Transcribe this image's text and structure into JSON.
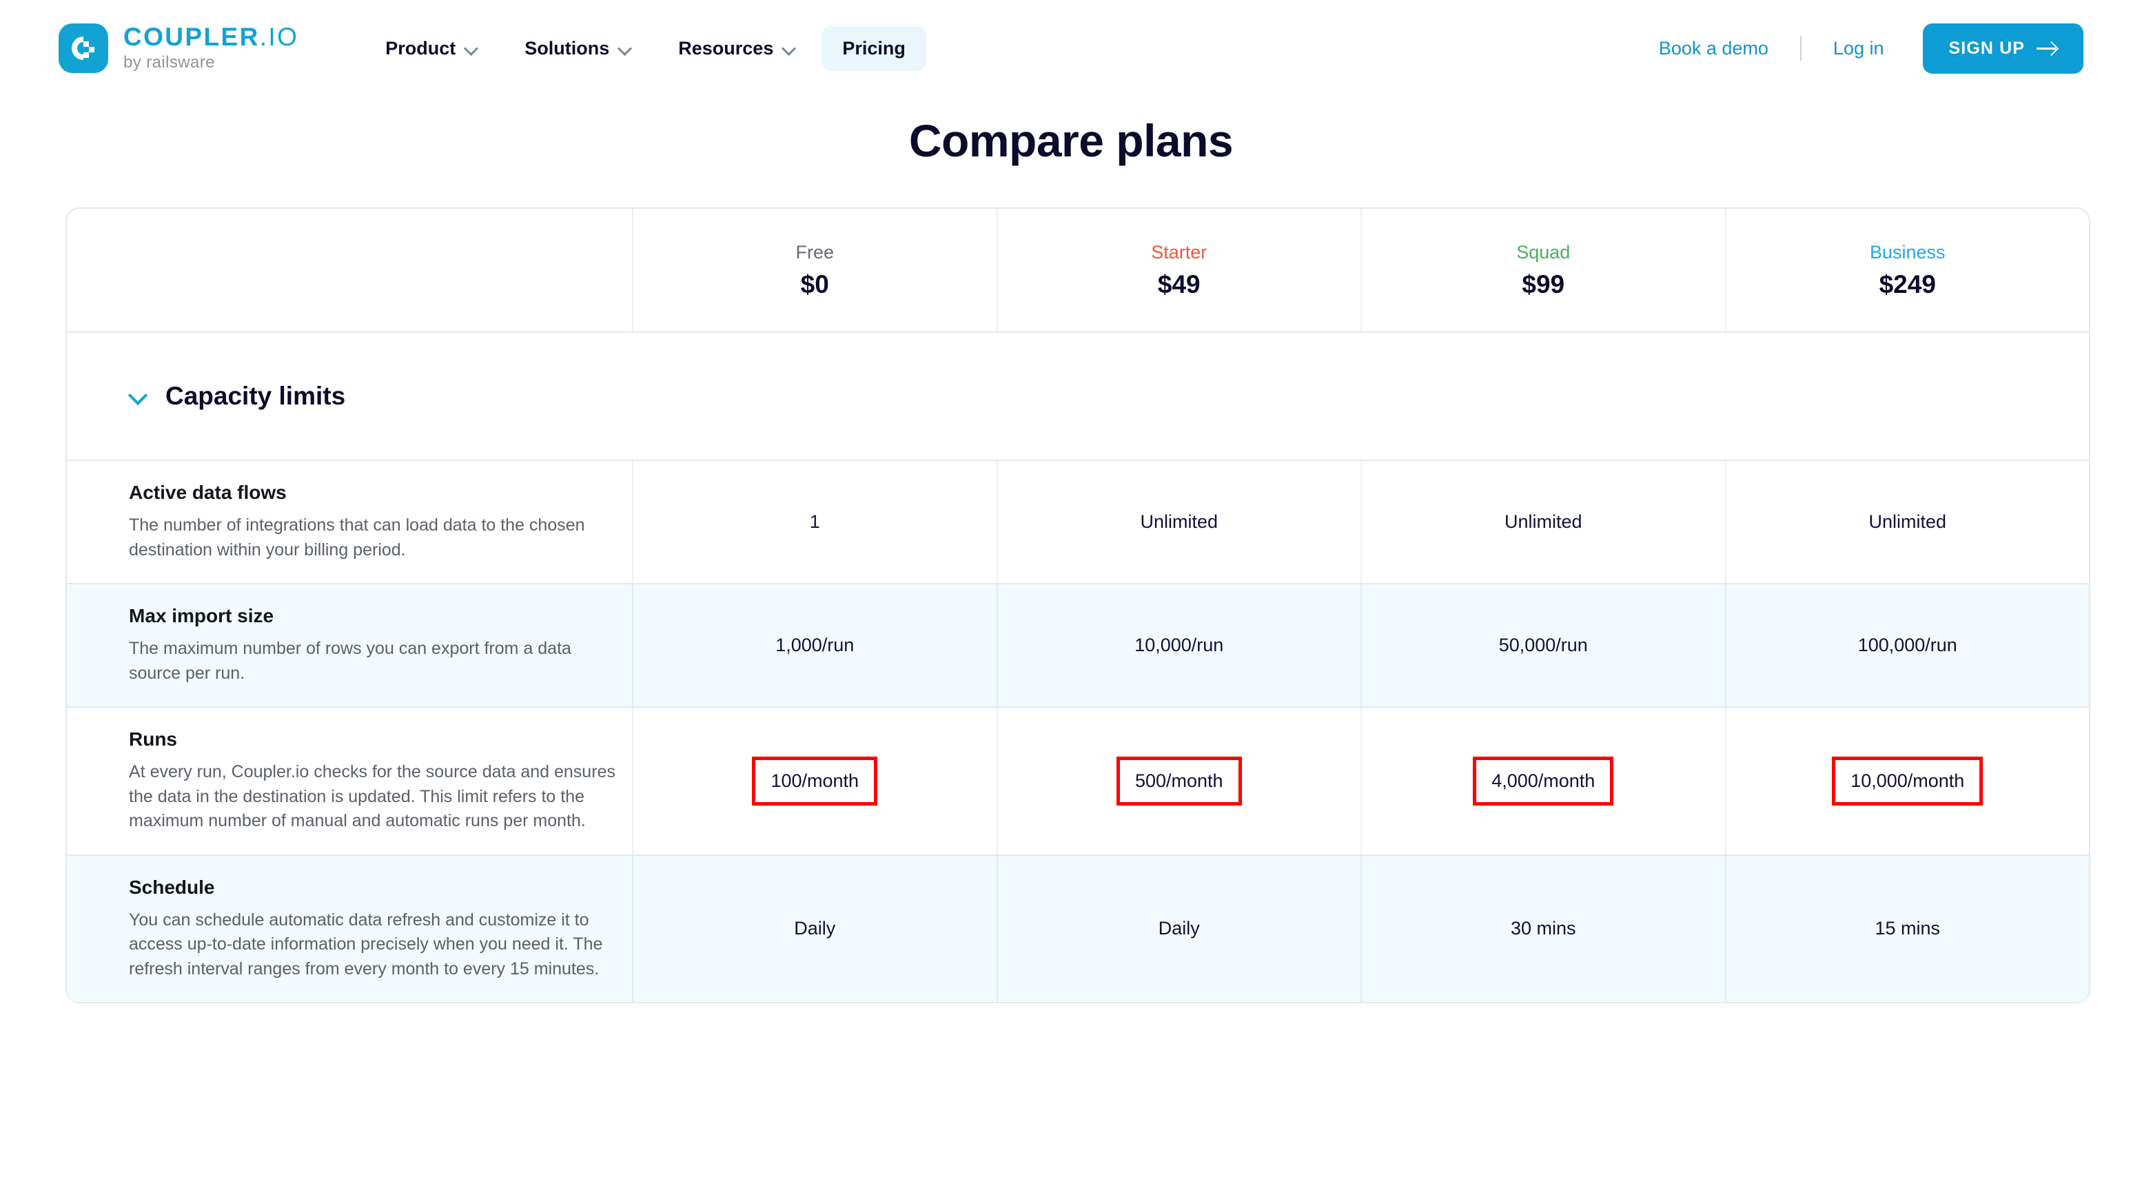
{
  "header": {
    "brand": {
      "name_part1": "COUPLER",
      "name_part2": ".IO",
      "tagline": "by railsware"
    },
    "nav": [
      {
        "label": "Product",
        "has_chevron": true,
        "active": false
      },
      {
        "label": "Solutions",
        "has_chevron": true,
        "active": false
      },
      {
        "label": "Resources",
        "has_chevron": true,
        "active": false
      },
      {
        "label": "Pricing",
        "has_chevron": false,
        "active": true
      }
    ],
    "book_demo": "Book a demo",
    "login": "Log in",
    "signup": "SIGN UP"
  },
  "page_title": "Compare plans",
  "plans": [
    {
      "name": "Free",
      "price": "$0",
      "color": "#646a73"
    },
    {
      "name": "Starter",
      "price": "$49",
      "color": "#F0553C"
    },
    {
      "name": "Squad",
      "price": "$99",
      "color": "#4BAF5E"
    },
    {
      "name": "Business",
      "price": "$249",
      "color": "#23A7EA"
    }
  ],
  "section": {
    "title": "Capacity limits"
  },
  "features": [
    {
      "title": "Active data flows",
      "description": "The number of integrations that can load data to the chosen destination within your billing period.",
      "values": [
        "1",
        "Unlimited",
        "Unlimited",
        "Unlimited"
      ],
      "shaded": false,
      "highlighted": false
    },
    {
      "title": "Max import size",
      "description": "The maximum number of rows you can export from a data source per run.",
      "values": [
        "1,000/run",
        "10,000/run",
        "50,000/run",
        "100,000/run"
      ],
      "shaded": true,
      "highlighted": false
    },
    {
      "title": "Runs",
      "description": "At every run, Coupler.io checks for the source data and ensures the data in the destination is updated. This limit refers to the maximum number of manual and automatic runs per month.",
      "values": [
        "100/month",
        "500/month",
        "4,000/month",
        "10,000/month"
      ],
      "shaded": false,
      "highlighted": true
    },
    {
      "title": "Schedule",
      "description": "You can schedule automatic data refresh and customize it to access up-to-date information precisely when you need it. The refresh interval ranges from every month to every 15 minutes.",
      "values": [
        "Daily",
        "Daily",
        "30 mins",
        "15 mins"
      ],
      "shaded": true,
      "highlighted": false
    }
  ],
  "colors": {
    "brand_blue": "#12A3D4",
    "highlight_red": "#FF0000",
    "shaded_row": "#F2FAFD",
    "text_dark": "#0B0B2B"
  }
}
